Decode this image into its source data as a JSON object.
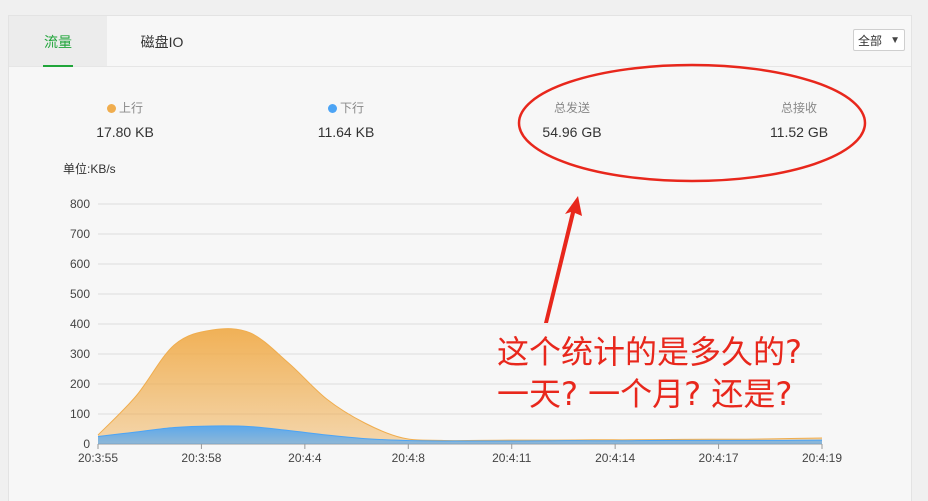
{
  "tabs": [
    {
      "label": "流量",
      "active": true
    },
    {
      "label": "磁盘IO",
      "active": false
    }
  ],
  "range_select": {
    "value": "全部"
  },
  "stats": {
    "up": {
      "label": "上行",
      "value": "17.80 KB",
      "color": "#f0ad4e"
    },
    "down": {
      "label": "下行",
      "value": "11.64 KB",
      "color": "#4ca4f5"
    },
    "total_sent": {
      "label": "总发送",
      "value": "54.96 GB"
    },
    "total_recv": {
      "label": "总接收",
      "value": "11.52 GB"
    }
  },
  "chart_data": {
    "type": "area",
    "ylabel": "单位:KB/s",
    "ylim": [
      0,
      800
    ],
    "yticks": [
      "0",
      "100",
      "200",
      "300",
      "400",
      "500",
      "600",
      "700",
      "800"
    ],
    "xticks": [
      "20:3:55",
      "20:3:58",
      "20:4:4",
      "20:4:8",
      "20:4:11",
      "20:4:14",
      "20:4:17",
      "20:4:19"
    ],
    "grid": true,
    "series": [
      {
        "name": "上行",
        "color": "#f0ad4e",
        "points": [
          [
            0,
            30
          ],
          [
            1,
            160
          ],
          [
            2,
            330
          ],
          [
            3,
            380
          ],
          [
            4,
            370
          ],
          [
            5,
            270
          ],
          [
            6,
            150
          ],
          [
            7,
            70
          ],
          [
            8,
            20
          ],
          [
            9,
            12
          ],
          [
            10,
            12
          ],
          [
            11,
            13
          ],
          [
            12,
            13
          ],
          [
            13,
            14
          ],
          [
            14,
            14
          ],
          [
            15,
            15
          ],
          [
            16,
            16
          ],
          [
            17,
            16
          ],
          [
            18,
            18
          ],
          [
            19,
            20
          ]
        ]
      },
      {
        "name": "下行",
        "color": "#4ca4f5",
        "points": [
          [
            0,
            25
          ],
          [
            1,
            40
          ],
          [
            2,
            55
          ],
          [
            3,
            60
          ],
          [
            4,
            58
          ],
          [
            5,
            45
          ],
          [
            6,
            30
          ],
          [
            7,
            18
          ],
          [
            8,
            12
          ],
          [
            9,
            10
          ],
          [
            10,
            10
          ],
          [
            11,
            10
          ],
          [
            12,
            11
          ],
          [
            13,
            11
          ],
          [
            14,
            11
          ],
          [
            15,
            12
          ],
          [
            16,
            12
          ],
          [
            17,
            12
          ],
          [
            18,
            12
          ],
          [
            19,
            13
          ]
        ]
      }
    ]
  },
  "annotation": {
    "line1": "这个统计的是多久的?",
    "line2": "一天?  一个月?  还是?",
    "color": "#e8271c"
  }
}
